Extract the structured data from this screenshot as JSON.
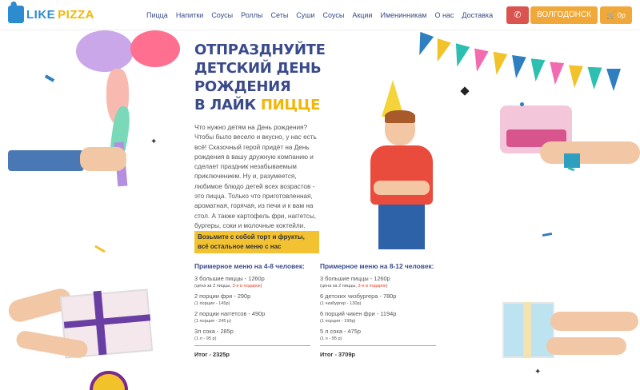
{
  "header": {
    "logo_like": "LIKE",
    "logo_pizza": "PIZZA",
    "nav": [
      "Пицца",
      "Напитки",
      "Соусы",
      "Роллы",
      "Сеты",
      "Суши",
      "Соусы",
      "Акции",
      "Именинникам",
      "О нас",
      "Доставка"
    ],
    "city_label": "ВОЛГОДОНСК",
    "cart_label": "0р",
    "phone_icon": "phone-icon",
    "cart_icon": "cart-icon"
  },
  "hero": {
    "title_line1": "ОТПРАЗДНУЙТЕ",
    "title_line2": "ДЕТСКИЙ ДЕНЬ",
    "title_line3": "РОЖДЕНИЯ",
    "title_line4a": "В ЛАЙК ",
    "title_line4b": "ПИЦЦЕ",
    "intro": "Что нужно детям на День рождения? Чтобы было весело и вкусно, у нас есть всё! Сказочный герой придёт на День рождения в вашу дружную компанию и сделает праздник незабываемым приключением. Ну и, разумеется, любимое блюдо детей всех возрастов - это пицца. Только что приготовленная, ароматная, горячая, из печи и к вам на стол. А также картофель фри, наггетсы, бургеры, соки и молочные коктейли.",
    "callout": "Возьмите с собой торт и фрукты, всё остальное меню с нас"
  },
  "menu_small": {
    "heading": "Примерное меню на 4-8 человек:",
    "item1": "3 большие пиццы - 1260р",
    "note1a": "(цена за 2 пиццы, ",
    "note1b": "3-я в подарок",
    "note1c": ")",
    "item2": "2 порции фри - 290р",
    "note2": "(1 порция - 145р)",
    "item3": "2 порции наггетсов - 490р",
    "note3": "(1 порция - 245 р)",
    "item4": "3л сока - 285р",
    "note4": "(1 л - 95 р)",
    "total": "Итог - 2325р"
  },
  "menu_large": {
    "heading": "Примерное меню на 8-12 человек:",
    "item1": "3 большие пиццы - 1260р",
    "note1a": "(цена за 2 пиццы, ",
    "note1b": "3-я в подарок",
    "note1c": ")",
    "item2": "6 детских чизбургера - 780р",
    "note2": "(1 чизбургер - 130р)",
    "item3": "6 порций чикен фри - 1194р",
    "note3": "(1 порция - 199р)",
    "item4": "5 л сока - 475р",
    "note4": "(1 л - 95 р)",
    "total": "Итог - 3709р"
  },
  "colors": {
    "brand_blue": "#3a4a8a",
    "accent_yellow": "#f3c233",
    "button_orange": "#f0a83a",
    "button_red": "#d9534f",
    "highlight_red": "#e0452f"
  }
}
